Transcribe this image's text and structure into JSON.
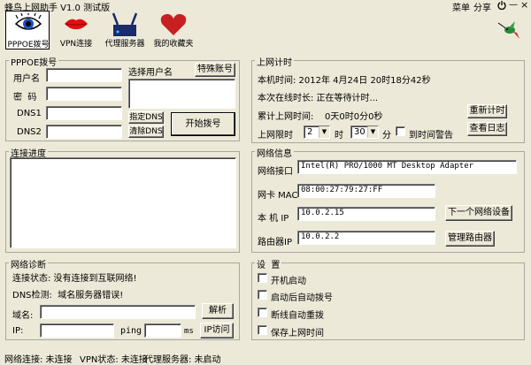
{
  "window": {
    "title": "蜂鸟上网助手 V1.0 测试版",
    "menu": [
      "菜单",
      "分享"
    ]
  },
  "toolbar": {
    "pppoe": "PPPOE拨号",
    "vpn": "VPN连接",
    "proxy": "代理服务器",
    "favorites": "我的收藏夹"
  },
  "pppoe": {
    "title": "PPPOE拨号",
    "username_label": "用户名",
    "password_label": "密  码",
    "dns1_label": "DNS1",
    "dns2_label": "DNS2",
    "username": "",
    "password": "",
    "dns1": "",
    "dns2": "",
    "select_user_label": "选择用户名",
    "special_account_btn": "特殊账号",
    "specify_dns_btn": "指定DNS",
    "clear_dns_btn": "清除DNS",
    "dial_btn": "开始拨号"
  },
  "timer": {
    "title": "上网计时",
    "local_time": "本机时间: 2012年 4月24日 20时18分42秒",
    "online_duration": "本次在线时长: 正在等待计时...",
    "total_label": "累计上网时间:",
    "total_value": "0天0时0分0秒",
    "reset_btn": "重新计时",
    "limit_label": "上网限时",
    "hours": "2",
    "hour_unit": "时",
    "minutes": "30",
    "minute_unit": "分",
    "alarm_label": "到时间警告",
    "log_btn": "查看日志"
  },
  "progress": {
    "title": "连接进度"
  },
  "netinfo": {
    "title": "网络信息",
    "interface_label": "网络接口",
    "interface_value": "Intel(R) PRO/1000 MT Desktop Adapter",
    "mac_label": "网卡 MAC",
    "mac_value": "08:00:27:79:27:FF",
    "ip_label": "本 机 IP",
    "ip_value": "10.0.2.15",
    "next_device_btn": "下一个网络设备",
    "router_label": "路由器IP",
    "router_value": "10.0.2.2",
    "manage_router_btn": "管理路由器"
  },
  "diag": {
    "title": "网络诊断",
    "connection_status": "连接状态: 没有连接到互联网络!",
    "dns_status": "DNS检测:  域名服务器错误!",
    "domain_label": "域名:",
    "domain_value": "",
    "resolve_btn": "解析",
    "ip_label": "IP:",
    "ip_value": "",
    "ping_label": "ping",
    "ping_value": "",
    "ms_label": "ms",
    "ip_visit_btn": "IP访问"
  },
  "settings": {
    "title": "设  置",
    "options": [
      "开机启动",
      "启动后自动拨号",
      "断线自动重拨",
      "保存上网时间"
    ]
  },
  "status": {
    "network": "网络连接: 未连接",
    "vpn": "VPN状态: 未连接",
    "proxy": "代理服务器: 未启动"
  },
  "colors": {
    "background": "#ece9d8",
    "lips": "#e01010",
    "heart": "#c82020",
    "eye": "#1e4fbf"
  },
  "icons": [
    "eye-icon",
    "lips-icon",
    "proxy-icon",
    "heart-icon",
    "hummingbird-logo",
    "power-icon",
    "minimize-icon",
    "close-icon"
  ]
}
